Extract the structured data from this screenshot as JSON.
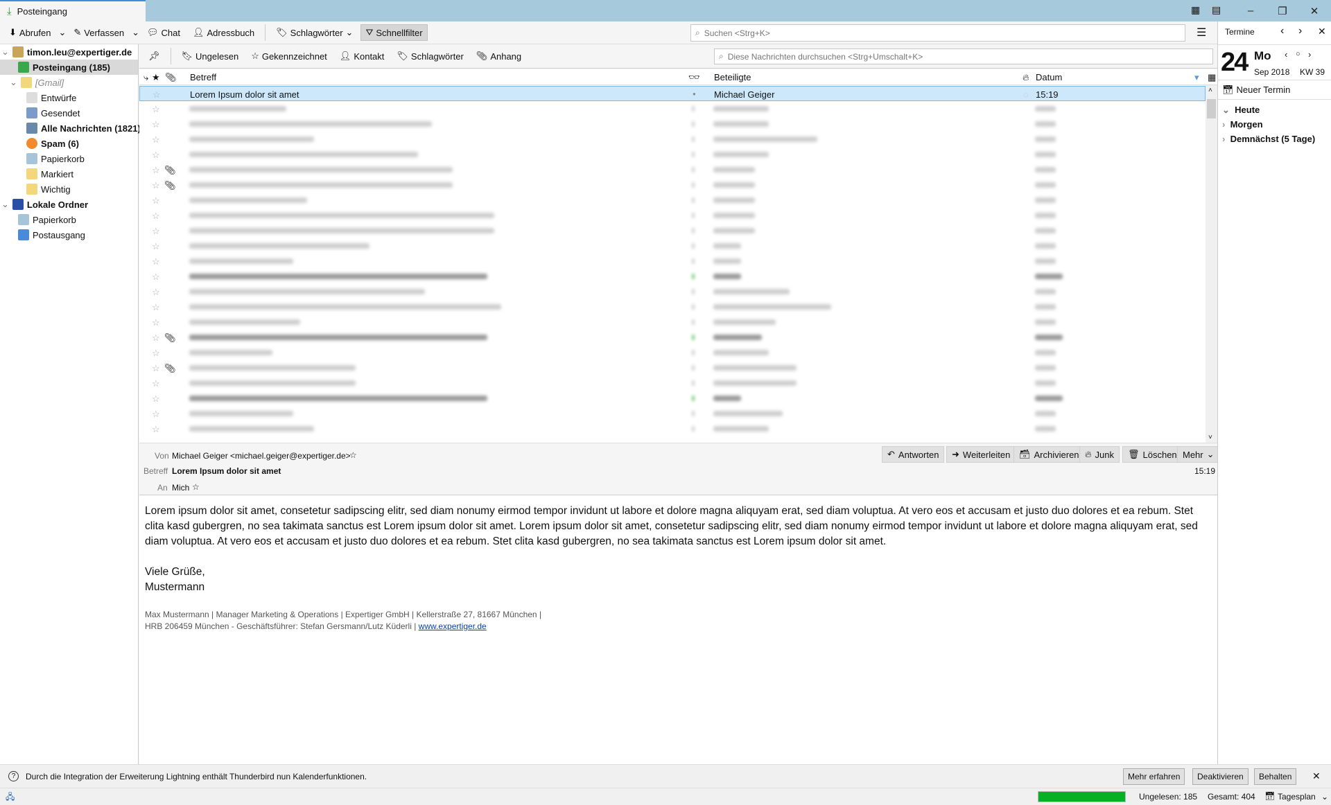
{
  "window": {
    "tab_title": "Posteingang",
    "controls": [
      "minimize",
      "restore",
      "close"
    ]
  },
  "toolbar": {
    "abrufen": "Abrufen",
    "verfassen": "Verfassen",
    "chat": "Chat",
    "adressbuch": "Adressbuch",
    "schlagwoerter": "Schlagwörter",
    "schnellfilter": "Schnellfilter",
    "search_placeholder": "Suchen <Strg+K>"
  },
  "folders": [
    {
      "label": "timon.leu@expertiger.de",
      "level": 0,
      "bold": true,
      "icon": "account-icon",
      "twisty": true
    },
    {
      "label": "Posteingang (185)",
      "level": 1,
      "bold": true,
      "icon": "inbox-icon",
      "selected": true
    },
    {
      "label": "[Gmail]",
      "level": 1,
      "italic": true,
      "icon": "folder-icon",
      "twisty": true
    },
    {
      "label": "Entwürfe",
      "level": 2,
      "icon": "drafts-icon"
    },
    {
      "label": "Gesendet",
      "level": 2,
      "icon": "sent-icon"
    },
    {
      "label": "Alle Nachrichten (1821)",
      "level": 2,
      "bold": true,
      "icon": "archive-icon"
    },
    {
      "label": "Spam (6)",
      "level": 2,
      "bold": true,
      "icon": "spam-icon"
    },
    {
      "label": "Papierkorb",
      "level": 2,
      "icon": "trash-icon"
    },
    {
      "label": "Markiert",
      "level": 2,
      "icon": "folder-icon"
    },
    {
      "label": "Wichtig",
      "level": 2,
      "icon": "folder-icon"
    },
    {
      "label": "Lokale Ordner",
      "level": 0,
      "bold": true,
      "icon": "local-folders-icon",
      "twisty": true
    },
    {
      "label": "Papierkorb",
      "level": 1,
      "icon": "trash-icon"
    },
    {
      "label": "Postausgang",
      "level": 1,
      "icon": "outbox-icon"
    }
  ],
  "quickfilter": {
    "ungelesen": "Ungelesen",
    "gekennzeichnet": "Gekennzeichnet",
    "kontakt": "Kontakt",
    "schlagwoerter": "Schlagwörter",
    "anhang": "Anhang",
    "search_placeholder": "Diese Nachrichten durchsuchen <Strg+Umschalt+K>"
  },
  "columns": {
    "betreff": "Betreff",
    "beteiligte": "Beteiligte",
    "datum": "Datum"
  },
  "selected_message": {
    "subject": "Lorem Ipsum dolor sit amet",
    "from": "Michael Geiger",
    "date": "15:19"
  },
  "blurred_rows": {
    "count": 22,
    "attachment_rows": [
      4,
      5,
      15,
      17
    ],
    "unread_rows": [
      11,
      15,
      19
    ]
  },
  "message": {
    "von_label": "Von",
    "von": "Michael Geiger <michael.geiger@expertiger.de>",
    "betreff_label": "Betreff",
    "betreff": "Lorem Ipsum dolor sit amet",
    "an_label": "An",
    "an": "Mich",
    "time": "15:19",
    "buttons": {
      "antworten": "Antworten",
      "weiterleiten": "Weiterleiten",
      "archivieren": "Archivieren",
      "junk": "Junk",
      "loeschen": "Löschen",
      "mehr": "Mehr"
    },
    "body": "Lorem ipsum dolor sit amet, consetetur sadipscing elitr, sed diam nonumy eirmod tempor invidunt ut labore et dolore magna aliquyam erat, sed diam voluptua. At vero eos et accusam et justo duo dolores et ea rebum. Stet clita kasd gubergren, no sea takimata sanctus est Lorem ipsum dolor sit amet. Lorem ipsum dolor sit amet, consetetur sadipscing elitr, sed diam nonumy eirmod tempor invidunt ut labore et dolore magna aliquyam erat, sed diam voluptua. At vero eos et accusam et justo duo dolores et ea rebum. Stet clita kasd gubergren, no sea takimata sanctus est Lorem ipsum dolor sit amet.",
    "greeting": "Viele Grüße,",
    "name": "Mustermann",
    "sig1": "Max Mustermann | Manager Marketing & Operations | Expertiger GmbH | Kellerstraße 27, 81667 München |",
    "sig2": "HRB 206459 München - Geschäftsführer: Stefan Gersmann/Lutz Küderli |",
    "sig_link": "www.expertiger.de"
  },
  "calendar": {
    "title": "Termine",
    "day": "24",
    "weekday": "Mo",
    "month_year": "Sep 2018",
    "week": "KW 39",
    "new_event": "Neuer Termin",
    "sections": [
      "Heute",
      "Morgen",
      "Demnächst (5 Tage)"
    ]
  },
  "notification": {
    "text": "Durch die Integration der Erweiterung Lightning enthält Thunderbird nun Kalenderfunktionen.",
    "mehr": "Mehr erfahren",
    "deaktivieren": "Deaktivieren",
    "behalten": "Behalten"
  },
  "status": {
    "progress": 100,
    "ungelesen": "Ungelesen: 185",
    "gesamt": "Gesamt: 404",
    "tagesplan": "Tagesplan",
    "progress_color": "#06b025"
  }
}
